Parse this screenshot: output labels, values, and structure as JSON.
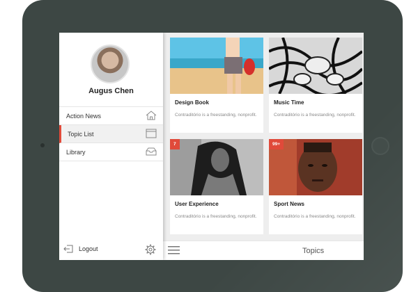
{
  "sidebar": {
    "user_name": "Augus Chen",
    "items": [
      {
        "label": "Action News",
        "icon": "home-icon",
        "active": false
      },
      {
        "label": "Topic List",
        "icon": "window-icon",
        "active": true
      },
      {
        "label": "Library",
        "icon": "inbox-icon",
        "active": false
      }
    ],
    "logout_label": "Logout"
  },
  "cards": [
    {
      "title": "Design Book",
      "desc": "Contraditório is a freestanding, nonprofit.",
      "badge": ""
    },
    {
      "title": "Music Time",
      "desc": "Contraditório is a freestanding, nonprofit.",
      "badge": ""
    },
    {
      "title": "User Experience",
      "desc": "Contraditório is a freestanding, nonprofit.",
      "badge": "7"
    },
    {
      "title": "Sport News",
      "desc": "Contraditório is a freestanding, nonprofit.",
      "badge": "99+"
    }
  ],
  "bottom_bar": {
    "title": "Topics",
    "menu_icon": "hamburger-icon"
  },
  "colors": {
    "accent": "#e04a3a",
    "device": "#3d4744"
  }
}
